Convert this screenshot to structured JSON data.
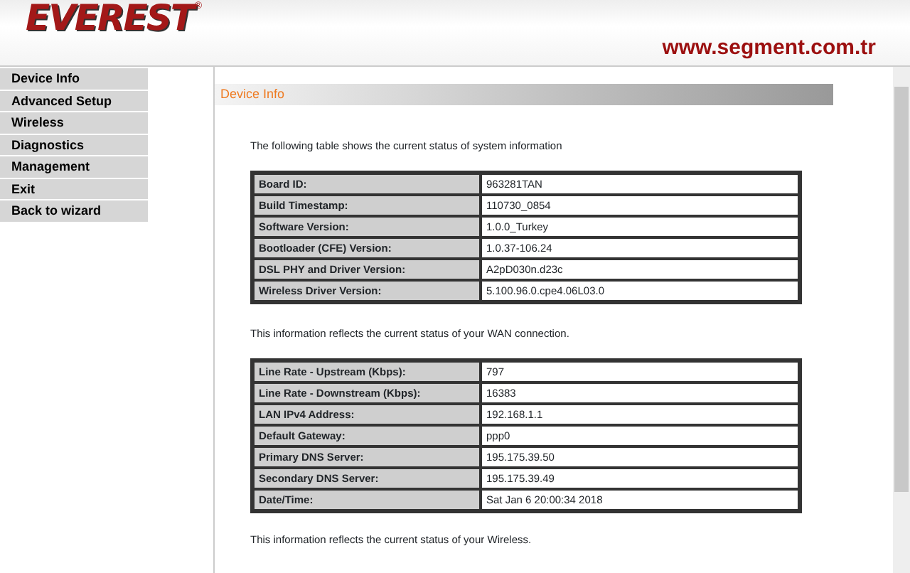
{
  "header": {
    "logo": "EVEREST",
    "registered": "®",
    "site": "www.segment.com.tr"
  },
  "sidebar": {
    "items": [
      {
        "label": "Device Info"
      },
      {
        "label": "Advanced Setup"
      },
      {
        "label": "Wireless"
      },
      {
        "label": "Diagnostics"
      },
      {
        "label": "Management"
      },
      {
        "label": "Exit"
      },
      {
        "label": "Back to wizard"
      }
    ]
  },
  "page_title": "Device Info",
  "sections": [
    {
      "intro": "The following table shows the current status of system information",
      "rows": [
        {
          "label": "Board ID:",
          "value": "963281TAN"
        },
        {
          "label": "Build Timestamp:",
          "value": "110730_0854"
        },
        {
          "label": "Software Version:",
          "value": "1.0.0_Turkey"
        },
        {
          "label": "Bootloader (CFE) Version:",
          "value": "1.0.37-106.24"
        },
        {
          "label": "DSL PHY and Driver Version:",
          "value": "A2pD030n.d23c"
        },
        {
          "label": "Wireless Driver Version:",
          "value": "5.100.96.0.cpe4.06L03.0"
        }
      ]
    },
    {
      "intro": "This information reflects the current status of your WAN connection.",
      "rows": [
        {
          "label": "Line Rate - Upstream (Kbps):",
          "value": "797"
        },
        {
          "label": "Line Rate - Downstream (Kbps):",
          "value": "16383"
        },
        {
          "label": "LAN IPv4 Address:",
          "value": "192.168.1.1"
        },
        {
          "label": "Default Gateway:",
          "value": "ppp0"
        },
        {
          "label": "Primary DNS Server:",
          "value": "195.175.39.50"
        },
        {
          "label": "Secondary DNS Server:",
          "value": "195.175.39.49"
        },
        {
          "label": "Date/Time:",
          "value": "Sat Jan 6 20:00:34 2018"
        }
      ]
    },
    {
      "intro": "This information reflects the current status of your Wireless."
    }
  ]
}
